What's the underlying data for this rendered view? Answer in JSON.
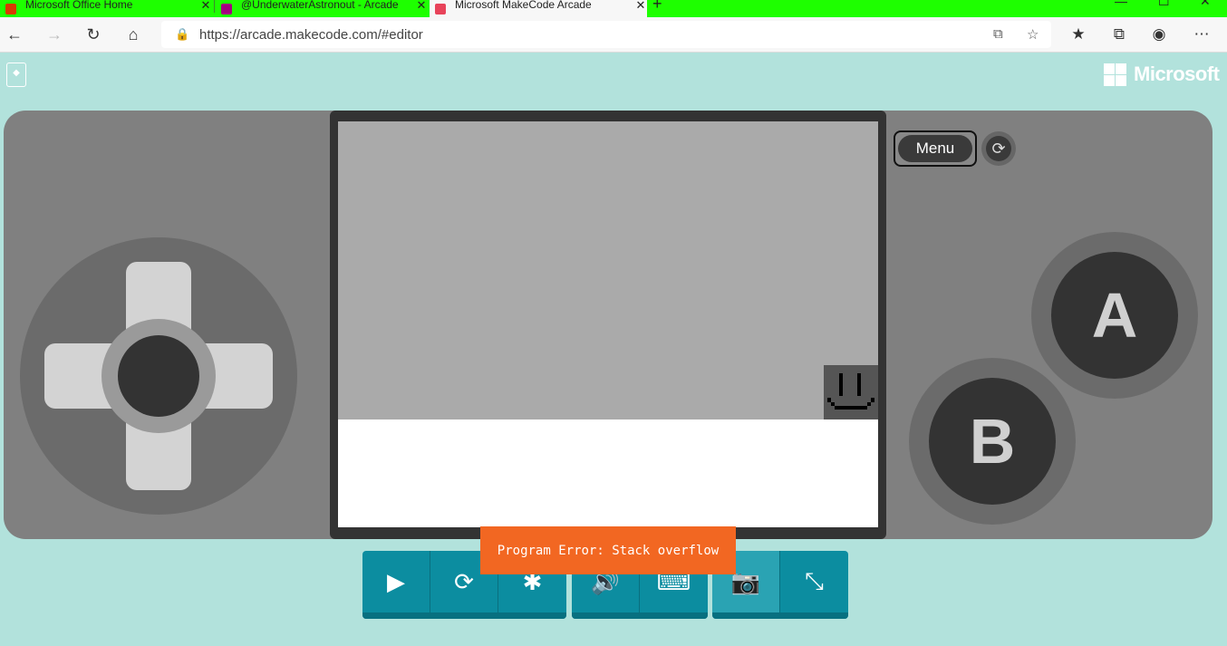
{
  "browser": {
    "tabs": [
      {
        "label": "Microsoft Office Home",
        "active": false
      },
      {
        "label": "@UnderwaterAstronout - Arcade",
        "active": false
      },
      {
        "label": "Microsoft MakeCode Arcade",
        "active": true
      }
    ],
    "url": "https://arcade.makecode.com/#editor",
    "tab_strip_color": "#1eff00"
  },
  "page": {
    "brand": "Microsoft",
    "menu_label": "Menu",
    "button_a_label": "A",
    "button_b_label": "B",
    "error_toast": "Program Error: Stack overflow",
    "background_color": "#b2e2dc",
    "toolbar_color": "#0c8da0",
    "toast_color": "#f26722"
  },
  "toolbar": {
    "groups": [
      [
        {
          "icon": "play-icon"
        },
        {
          "icon": "restart-icon"
        },
        {
          "icon": "debug-icon"
        }
      ],
      [
        {
          "icon": "volume-icon"
        },
        {
          "icon": "keyboard-icon"
        }
      ],
      [
        {
          "icon": "screenshot-icon"
        },
        {
          "icon": "exit-fullscreen-icon"
        }
      ]
    ]
  }
}
